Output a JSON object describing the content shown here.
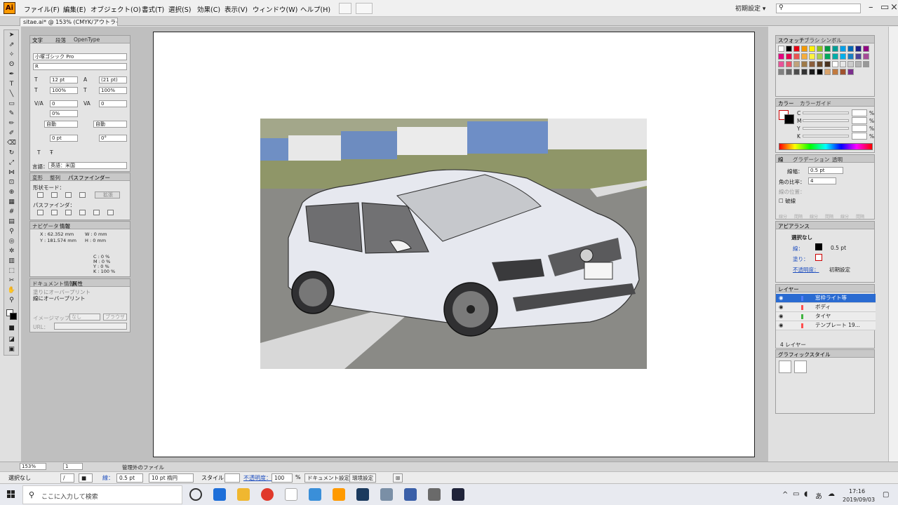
{
  "app": {
    "logo": "Ai",
    "workspace": "初期設定"
  },
  "menu": [
    "ファイル(F)",
    "編集(E)",
    "オブジェクト(O)",
    "書式(T)",
    "選択(S)",
    "効果(C)",
    "表示(V)",
    "ウィンドウ(W)",
    "ヘルプ(H)"
  ],
  "doc_tab": {
    "title": "sitae.ai* @ 153% (CMYK/アウトライン)",
    "close": "×"
  },
  "char_panel": {
    "tabs": [
      "文字",
      "段落",
      "OpenType"
    ],
    "font_family": "小塚ゴシック Pro",
    "font_style": "R",
    "font_size": "12 pt",
    "leading": "(21 pt)",
    "vscale": "100%",
    "hscale": "100%",
    "kerning": "0",
    "tracking": "0",
    "tsume": "0%",
    "aki_before": "自動",
    "aki_after": "自動",
    "baseline": "0 pt",
    "rotation": "0°",
    "lang_label": "言語：",
    "language": "英語：米国"
  },
  "transform_panel": {
    "tabs": [
      "変形",
      "整列",
      "パスファインダー"
    ],
    "shape_mode": "形状モード：",
    "expand": "拡張",
    "pathfinder": "パスファインダ："
  },
  "info_panel": {
    "tabs": [
      "ナビゲータ",
      "情報"
    ],
    "x": "X : 62.352 mm",
    "y": "Y : 181.574 mm",
    "w": "W : 0 mm",
    "h": "H : 0 mm",
    "c": "C : 0 %",
    "m": "M : 0 %",
    "yv": "Y : 0 %",
    "k": "K : 100 %"
  },
  "attr_panel": {
    "tabs": [
      "ドキュメント情報",
      "属性"
    ],
    "overprint_fill": "塗りにオーバープリント",
    "overprint_stroke": "線にオーバープリント",
    "imagemap_label": "イメージマップ：",
    "imagemap_value": "なし",
    "browse": "ブラウザ",
    "url_label": "URL："
  },
  "swatch_panel": {
    "tabs": [
      "スウォッチ",
      "ブラシ",
      "シンボル"
    ]
  },
  "color_panel": {
    "tabs": [
      "カラー",
      "カラーガイド"
    ],
    "channels": [
      "C",
      "M",
      "Y",
      "K"
    ],
    "unit": "%"
  },
  "stroke_panel": {
    "tabs": [
      "線",
      "グラデーション",
      "透明"
    ],
    "weight_label": "線幅：",
    "weight": "0.5 pt",
    "miter_label": "角の比率：",
    "miter": "4",
    "align_label": "線の位置：",
    "dashed": "破線",
    "dash_labels": [
      "線分",
      "間隔",
      "線分",
      "間隔",
      "線分",
      "間隔"
    ]
  },
  "appearance_panel": {
    "title": "アピアランス",
    "no_selection": "選択なし",
    "stroke_label": "線：",
    "stroke_value": "0.5 pt",
    "fill_label": "塗り：",
    "opacity_label": "不透明度：",
    "opacity_value": "初期設定"
  },
  "layers_panel": {
    "title": "レイヤー",
    "layers": [
      "窓枠ライト等",
      "ボディ",
      "タイヤ",
      "テンプレート 19..."
    ],
    "layer_colors": [
      "#4f7cff",
      "#ff4f4f",
      "#3fb43f",
      "#ff4f4f"
    ],
    "count": "4 レイヤー"
  },
  "graphic_styles_panel": {
    "title": "グラフィックスタイル"
  },
  "status": {
    "zoom": "153%",
    "artboard": "1",
    "info": "管理外のファイル"
  },
  "control_bar": {
    "selection": "選択なし",
    "stroke_label": "線：",
    "stroke_weight": "0.5 pt",
    "brush": "10 pt 楕円",
    "style_label": "スタイル：",
    "opacity_label": "不透明度：",
    "opacity": "100",
    "pct": "%",
    "doc_setup": "ドキュメント設定",
    "prefs": "環境設定"
  },
  "taskbar": {
    "search": "ここに入力して検索",
    "time": "17:16",
    "date": "2019/09/03",
    "ime": "あ"
  },
  "colors": {
    "ui_bg": "#e4e4e4",
    "selection": "#2a6bd1",
    "ai_orange": "#ff9a00"
  }
}
